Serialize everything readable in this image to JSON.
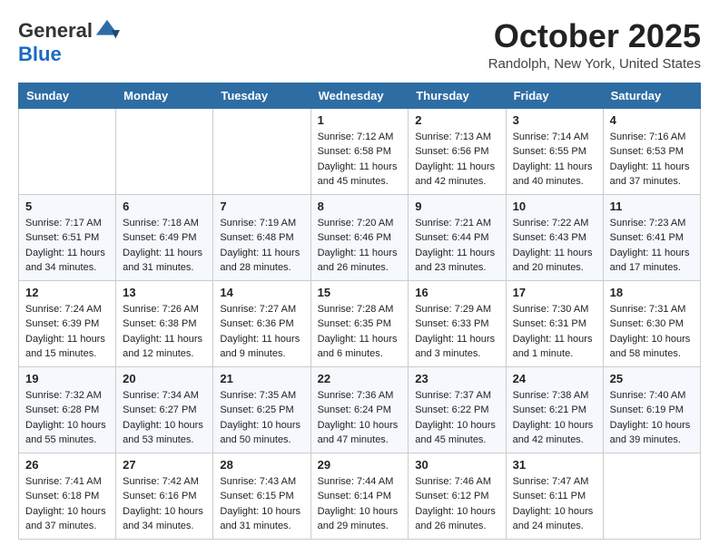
{
  "header": {
    "logo_general": "General",
    "logo_blue": "Blue",
    "month_title": "October 2025",
    "location": "Randolph, New York, United States"
  },
  "days_of_week": [
    "Sunday",
    "Monday",
    "Tuesday",
    "Wednesday",
    "Thursday",
    "Friday",
    "Saturday"
  ],
  "weeks": [
    [
      {
        "day": "",
        "info": ""
      },
      {
        "day": "",
        "info": ""
      },
      {
        "day": "",
        "info": ""
      },
      {
        "day": "1",
        "info": "Sunrise: 7:12 AM\nSunset: 6:58 PM\nDaylight: 11 hours and 45 minutes."
      },
      {
        "day": "2",
        "info": "Sunrise: 7:13 AM\nSunset: 6:56 PM\nDaylight: 11 hours and 42 minutes."
      },
      {
        "day": "3",
        "info": "Sunrise: 7:14 AM\nSunset: 6:55 PM\nDaylight: 11 hours and 40 minutes."
      },
      {
        "day": "4",
        "info": "Sunrise: 7:16 AM\nSunset: 6:53 PM\nDaylight: 11 hours and 37 minutes."
      }
    ],
    [
      {
        "day": "5",
        "info": "Sunrise: 7:17 AM\nSunset: 6:51 PM\nDaylight: 11 hours and 34 minutes."
      },
      {
        "day": "6",
        "info": "Sunrise: 7:18 AM\nSunset: 6:49 PM\nDaylight: 11 hours and 31 minutes."
      },
      {
        "day": "7",
        "info": "Sunrise: 7:19 AM\nSunset: 6:48 PM\nDaylight: 11 hours and 28 minutes."
      },
      {
        "day": "8",
        "info": "Sunrise: 7:20 AM\nSunset: 6:46 PM\nDaylight: 11 hours and 26 minutes."
      },
      {
        "day": "9",
        "info": "Sunrise: 7:21 AM\nSunset: 6:44 PM\nDaylight: 11 hours and 23 minutes."
      },
      {
        "day": "10",
        "info": "Sunrise: 7:22 AM\nSunset: 6:43 PM\nDaylight: 11 hours and 20 minutes."
      },
      {
        "day": "11",
        "info": "Sunrise: 7:23 AM\nSunset: 6:41 PM\nDaylight: 11 hours and 17 minutes."
      }
    ],
    [
      {
        "day": "12",
        "info": "Sunrise: 7:24 AM\nSunset: 6:39 PM\nDaylight: 11 hours and 15 minutes."
      },
      {
        "day": "13",
        "info": "Sunrise: 7:26 AM\nSunset: 6:38 PM\nDaylight: 11 hours and 12 minutes."
      },
      {
        "day": "14",
        "info": "Sunrise: 7:27 AM\nSunset: 6:36 PM\nDaylight: 11 hours and 9 minutes."
      },
      {
        "day": "15",
        "info": "Sunrise: 7:28 AM\nSunset: 6:35 PM\nDaylight: 11 hours and 6 minutes."
      },
      {
        "day": "16",
        "info": "Sunrise: 7:29 AM\nSunset: 6:33 PM\nDaylight: 11 hours and 3 minutes."
      },
      {
        "day": "17",
        "info": "Sunrise: 7:30 AM\nSunset: 6:31 PM\nDaylight: 11 hours and 1 minute."
      },
      {
        "day": "18",
        "info": "Sunrise: 7:31 AM\nSunset: 6:30 PM\nDaylight: 10 hours and 58 minutes."
      }
    ],
    [
      {
        "day": "19",
        "info": "Sunrise: 7:32 AM\nSunset: 6:28 PM\nDaylight: 10 hours and 55 minutes."
      },
      {
        "day": "20",
        "info": "Sunrise: 7:34 AM\nSunset: 6:27 PM\nDaylight: 10 hours and 53 minutes."
      },
      {
        "day": "21",
        "info": "Sunrise: 7:35 AM\nSunset: 6:25 PM\nDaylight: 10 hours and 50 minutes."
      },
      {
        "day": "22",
        "info": "Sunrise: 7:36 AM\nSunset: 6:24 PM\nDaylight: 10 hours and 47 minutes."
      },
      {
        "day": "23",
        "info": "Sunrise: 7:37 AM\nSunset: 6:22 PM\nDaylight: 10 hours and 45 minutes."
      },
      {
        "day": "24",
        "info": "Sunrise: 7:38 AM\nSunset: 6:21 PM\nDaylight: 10 hours and 42 minutes."
      },
      {
        "day": "25",
        "info": "Sunrise: 7:40 AM\nSunset: 6:19 PM\nDaylight: 10 hours and 39 minutes."
      }
    ],
    [
      {
        "day": "26",
        "info": "Sunrise: 7:41 AM\nSunset: 6:18 PM\nDaylight: 10 hours and 37 minutes."
      },
      {
        "day": "27",
        "info": "Sunrise: 7:42 AM\nSunset: 6:16 PM\nDaylight: 10 hours and 34 minutes."
      },
      {
        "day": "28",
        "info": "Sunrise: 7:43 AM\nSunset: 6:15 PM\nDaylight: 10 hours and 31 minutes."
      },
      {
        "day": "29",
        "info": "Sunrise: 7:44 AM\nSunset: 6:14 PM\nDaylight: 10 hours and 29 minutes."
      },
      {
        "day": "30",
        "info": "Sunrise: 7:46 AM\nSunset: 6:12 PM\nDaylight: 10 hours and 26 minutes."
      },
      {
        "day": "31",
        "info": "Sunrise: 7:47 AM\nSunset: 6:11 PM\nDaylight: 10 hours and 24 minutes."
      },
      {
        "day": "",
        "info": ""
      }
    ]
  ]
}
